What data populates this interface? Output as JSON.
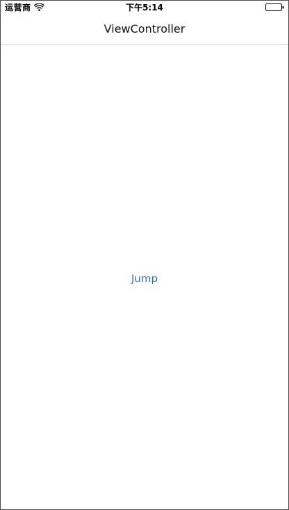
{
  "status_bar": {
    "carrier": "运营商",
    "time": "下午5:14",
    "wifi_icon": "wifi-icon",
    "battery_icon": "battery-icon"
  },
  "nav_bar": {
    "title": "ViewController"
  },
  "content": {
    "jump_label": "Jump"
  },
  "colors": {
    "button_tint": "#2f6fae",
    "background": "#ffffff",
    "separator": "#cfcfcf"
  }
}
